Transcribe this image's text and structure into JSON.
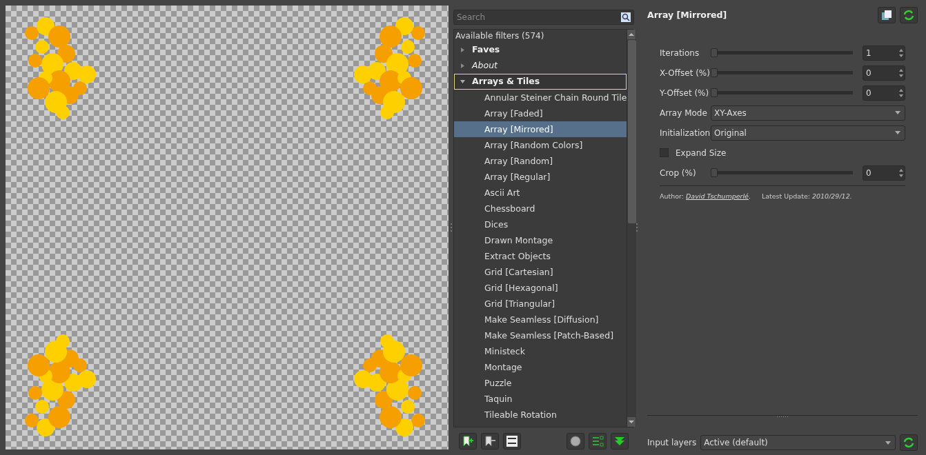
{
  "search": {
    "placeholder": "Search"
  },
  "filters": {
    "header": "Available filters (574)",
    "items": [
      {
        "label": "Faves",
        "bold": true,
        "italic": false,
        "expanded": false,
        "focused": false
      },
      {
        "label": "About",
        "bold": false,
        "italic": true,
        "expanded": false,
        "focused": false
      },
      {
        "label": "Arrays & Tiles",
        "bold": true,
        "italic": false,
        "expanded": true,
        "focused": true,
        "children": [
          {
            "label": "Annular Steiner Chain Round Tile",
            "selected": false
          },
          {
            "label": "Array [Faded]",
            "selected": false
          },
          {
            "label": "Array [Mirrored]",
            "selected": true
          },
          {
            "label": "Array [Random Colors]",
            "selected": false
          },
          {
            "label": "Array [Random]",
            "selected": false
          },
          {
            "label": "Array [Regular]",
            "selected": false
          },
          {
            "label": "Ascii Art",
            "selected": false
          },
          {
            "label": "Chessboard",
            "selected": false
          },
          {
            "label": "Dices",
            "selected": false
          },
          {
            "label": "Drawn Montage",
            "selected": false
          },
          {
            "label": "Extract Objects",
            "selected": false
          },
          {
            "label": "Grid [Cartesian]",
            "selected": false
          },
          {
            "label": "Grid [Hexagonal]",
            "selected": false
          },
          {
            "label": "Grid [Triangular]",
            "selected": false
          },
          {
            "label": "Make Seamless [Diffusion]",
            "selected": false
          },
          {
            "label": "Make Seamless [Patch-Based]",
            "selected": false
          },
          {
            "label": "Ministeck",
            "selected": false
          },
          {
            "label": "Montage",
            "selected": false
          },
          {
            "label": "Puzzle",
            "selected": false
          },
          {
            "label": "Taquin",
            "selected": false
          },
          {
            "label": "Tileable Rotation",
            "selected": false
          }
        ]
      }
    ]
  },
  "filter": {
    "title": "Array [Mirrored]",
    "params": [
      {
        "kind": "slider",
        "label": "Iterations",
        "level": 0,
        "value": "1"
      },
      {
        "kind": "slider",
        "label": "X-Offset (%)",
        "level": 0,
        "value": "0"
      },
      {
        "kind": "slider",
        "label": "Y-Offset (%)",
        "level": 0,
        "value": "0"
      },
      {
        "kind": "select",
        "label": "Array Mode",
        "value": "XY-Axes"
      },
      {
        "kind": "select",
        "label": "Initialization",
        "value": "Original"
      },
      {
        "kind": "checkbox",
        "label": "Expand Size",
        "checked": false
      },
      {
        "kind": "slider",
        "label": "Crop (%)",
        "level": 0,
        "value": "0"
      }
    ],
    "footer": {
      "author_label": "Author:",
      "author": "David Tschumperlé",
      "author_end": ".",
      "update_label": "Latest Update:",
      "update": "2010/29/12."
    }
  },
  "input_layers": {
    "label": "Input layers",
    "value": "Active (default)"
  }
}
